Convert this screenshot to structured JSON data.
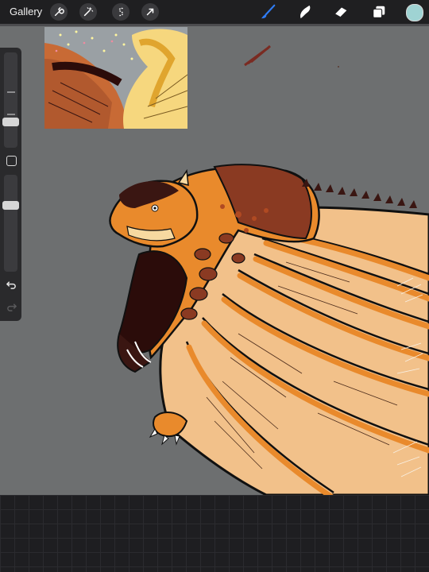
{
  "toolbar": {
    "gallery_label": "Gallery",
    "left_tools": [
      "wrench-icon",
      "magic-wand-icon",
      "selection-icon",
      "transform-arrow-icon"
    ],
    "right_tools": [
      "brush-icon",
      "smudge-icon",
      "eraser-icon",
      "layers-icon"
    ],
    "active_tool": "brush",
    "active_color": "#9fd3d3"
  },
  "sidebar": {
    "brush_size": 0.25,
    "opacity": 0.7,
    "buttons": [
      "modify-square",
      "undo-icon",
      "redo-icon"
    ]
  },
  "colors": {
    "canvas_bg": "#6d6f70",
    "wing_light": "#f2c18a",
    "wing_orange": "#e98a2c",
    "body_dark": "#3a1612",
    "body_brown": "#8a3a22"
  }
}
